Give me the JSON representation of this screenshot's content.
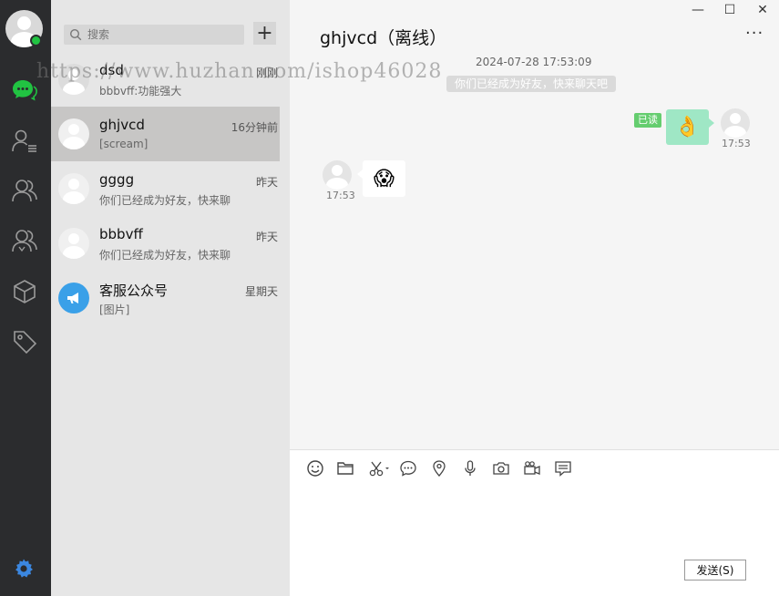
{
  "me": {
    "status": "online"
  },
  "rail": {
    "items": [
      "chat",
      "contacts",
      "friends",
      "groups",
      "apps",
      "tags"
    ],
    "accent": "#21c342",
    "settings_color": "#3b87e0"
  },
  "search": {
    "placeholder": "搜索"
  },
  "add_label": "+",
  "watermark": "https://www.huzhan.com/ishop46028",
  "conversations": [
    {
      "name": "dsd",
      "time": "刚刚",
      "message": "bbbvff:功能强大"
    },
    {
      "name": "ghjvcd",
      "time": "16分钟前",
      "message": "[scream]"
    },
    {
      "name": "gggg",
      "time": "昨天",
      "message": "你们已经成为好友，快来聊"
    },
    {
      "name": "bbbvff",
      "time": "昨天",
      "message": "你们已经成为好友，快来聊"
    },
    {
      "name": "客服公众号",
      "time": "星期天",
      "message": "[图片]"
    }
  ],
  "window": {
    "minimize": "—",
    "maximize": "☐",
    "close": "✕"
  },
  "chat": {
    "title": "ghjvcd（离线）",
    "more": "···",
    "timestamp": "2024-07-28 17:53:09",
    "system_notice": "你们已经成为好友，快来聊天吧",
    "messages": [
      {
        "direction": "out",
        "content": "👌",
        "time": "17:53",
        "status": "已读"
      },
      {
        "direction": "in",
        "content": "😱",
        "time": "17:53"
      }
    ]
  },
  "toolbar": [
    "emoji",
    "folder",
    "screenshot",
    "chat-bubble",
    "location",
    "microphone",
    "camera",
    "video",
    "history"
  ],
  "send_label": "发送(S)"
}
